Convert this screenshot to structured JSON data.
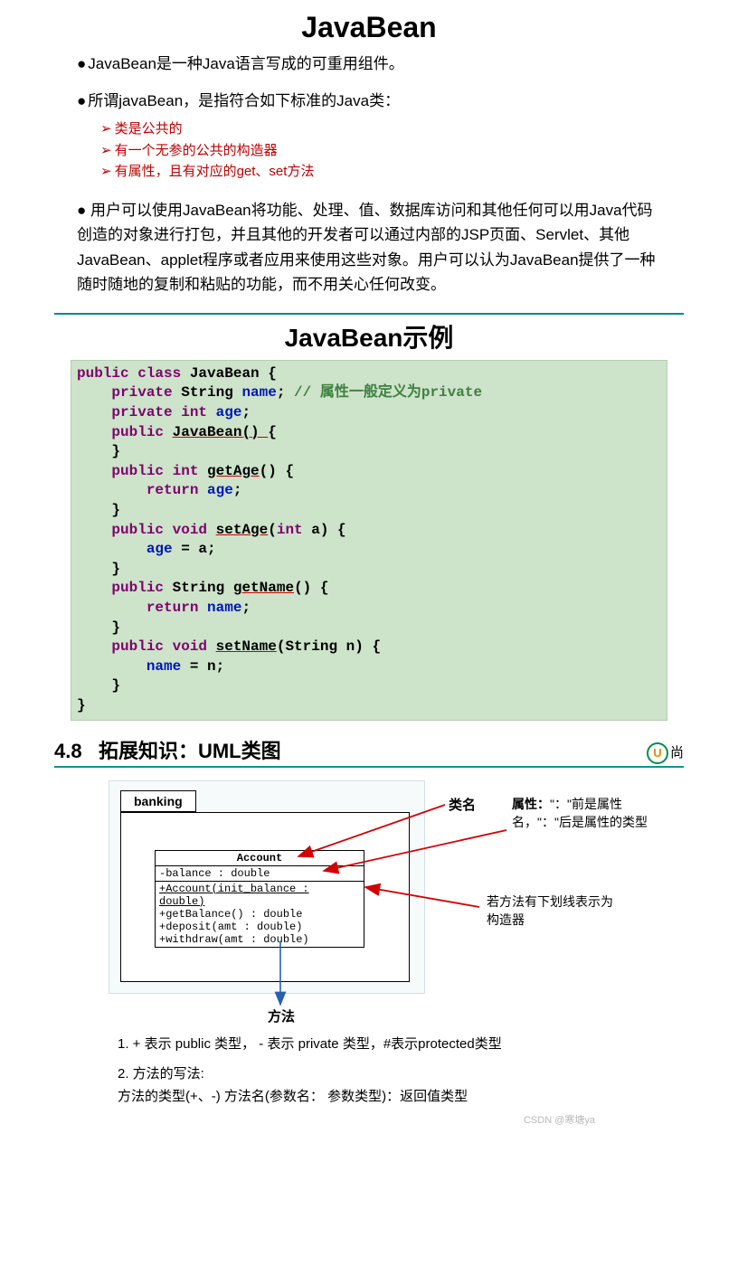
{
  "title_main": "JavaBean",
  "bullet1": "JavaBean是一种Java语言写成的可重用组件。",
  "bullet2": "所谓javaBean，是指符合如下标准的Java类：",
  "sub1": "类是公共的",
  "sub2": "有一个无参的公共的构造器",
  "sub3": "有属性，且有对应的get、set方法",
  "para": "用户可以使用JavaBean将功能、处理、值、数据库访问和其他任何可以用Java代码创造的对象进行打包，并且其他的开发者可以通过内部的JSP页面、Servlet、其他JavaBean、applet程序或者应用来使用这些对象。用户可以认为JavaBean提供了一种随时随地的复制和粘贴的功能，而不用关心任何改变。",
  "title_example": "JavaBean示例",
  "code": {
    "l1a": "public class ",
    "l1b": "JavaBean {",
    "l2a": "    private ",
    "l2b": "String ",
    "l2c": "name",
    "l2d": "; ",
    "l2e": "// 属性一般定义为private",
    "l3a": "    private int ",
    "l3b": "age",
    "l3c": ";",
    "l4a": "    public ",
    "l4b": "JavaBean() ",
    "l4c": "{",
    "l5": "    }",
    "l6a": "    public int ",
    "l6b": "getAge",
    "l6c": "() {",
    "l7a": "        return ",
    "l7b": "age",
    "l7c": ";",
    "l8": "    }",
    "l9a": "    public void ",
    "l9b": "setAge",
    "l9c": "(",
    "l9d": "int ",
    "l9e": "a) {",
    "l10a": "        ",
    "l10b": "age",
    "l10c": " = a;",
    "l11": "    }",
    "l12a": "    public ",
    "l12b": "String ",
    "l12c": "getName",
    "l12d": "() {",
    "l13a": "        return ",
    "l13b": "name",
    "l13c": ";",
    "l14": "    }",
    "l15a": "    public void ",
    "l15b": "setName",
    "l15c": "(String n) {",
    "l16a": "        ",
    "l16b": "name",
    "l16c": " = n;",
    "l17": "    }",
    "l18": "}"
  },
  "section_num": "4.8",
  "section_title": "拓展知识：UML类图",
  "logo_char": "U",
  "logo_txt": "尚",
  "uml": {
    "pkg": "banking",
    "cls_title": "Account",
    "attr1": "-balance : double",
    "ctor": "+Account(init_balance : double)",
    "m1": "+getBalance() : double",
    "m2": "+deposit(amt : double)",
    "m3": "+withdraw(amt : double)"
  },
  "lbl_class": "类名",
  "lbl_method": "方法",
  "note_attr": "属性：\"：\"前是属性名，\"：\"后是属性的类型",
  "note_attr_b": "属性：",
  "note_attr_rest": "\"：\"前是属性名，\"：\"后是属性的类型",
  "note_ctor": "若方法有下划线表示为构造器",
  "f1": "1. + 表示 public 类型， - 表示 private 类型，#表示protected类型",
  "f2a": "2. 方法的写法:",
  "f2b": "方法的类型(+、-)  方法名(参数名：  参数类型)：返回值类型",
  "watermark": "CSDN @寒塘ya"
}
